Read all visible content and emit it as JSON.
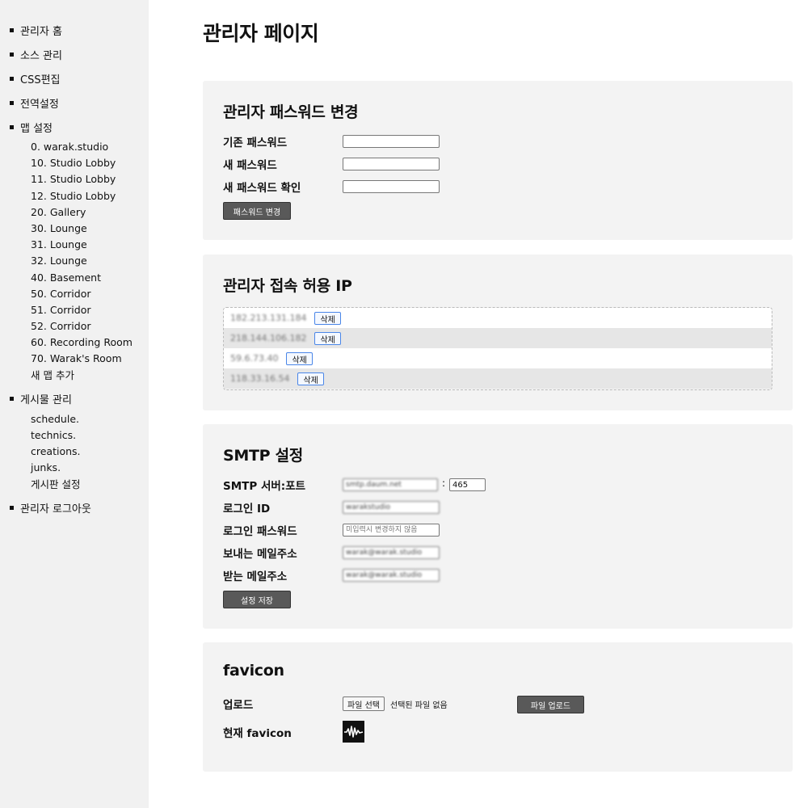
{
  "sidebar": {
    "home": "관리자 홈",
    "source": "소스 관리",
    "css": "CSS편집",
    "global": "전역설정",
    "maps": {
      "label": "맵 설정",
      "items": [
        "0. warak.studio",
        "10. Studio Lobby",
        "11. Studio Lobby",
        "12. Studio Lobby",
        "20. Gallery",
        "30. Lounge",
        "31. Lounge",
        "32. Lounge",
        "40. Basement",
        "50. Corridor",
        "51. Corridor",
        "52. Corridor",
        "60. Recording Room",
        "70. Warak's Room",
        "새 맵 추가"
      ]
    },
    "posts": {
      "label": "게시물 관리",
      "items": [
        "schedule.",
        "technics.",
        "creations.",
        "junks.",
        "게시판 설정"
      ]
    },
    "logout": "관리자 로그아웃"
  },
  "page": {
    "title": "관리자 페이지"
  },
  "password_panel": {
    "title": "관리자 패스워드 변경",
    "current_label": "기존 패스워드",
    "new_label": "새 패스워드",
    "confirm_label": "새 패스워드 확인",
    "button": "패스워드 변경"
  },
  "ip_panel": {
    "title": "관리자 접속 허용 IP",
    "delete_label": "삭제",
    "ips": [
      "182.213.131.184",
      "218.144.106.182",
      "59.6.73.40",
      "118.33.16.54"
    ]
  },
  "smtp_panel": {
    "title": "SMTP 설정",
    "server_label": "SMTP 서버:포트",
    "server_value": "smtp.daum.net",
    "colon": ":",
    "port_value": "465",
    "login_label": "로그인 ID",
    "login_value": "warakstudio",
    "password_label": "로그인 패스워드",
    "password_placeholder": "미입력시 변경하지 않음",
    "sender_label": "보내는 메일주소",
    "sender_value": "warak@warak.studio",
    "receiver_label": "받는 메일주소",
    "receiver_value": "warak@warak.studio",
    "button": "설정 저장"
  },
  "favicon_panel": {
    "title": "favicon",
    "upload_label": "업로드",
    "choose_button": "파일 선택",
    "no_file_text": "선택된 파일 없음",
    "upload_button": "파일 업로드",
    "current_label": "현재 favicon"
  }
}
